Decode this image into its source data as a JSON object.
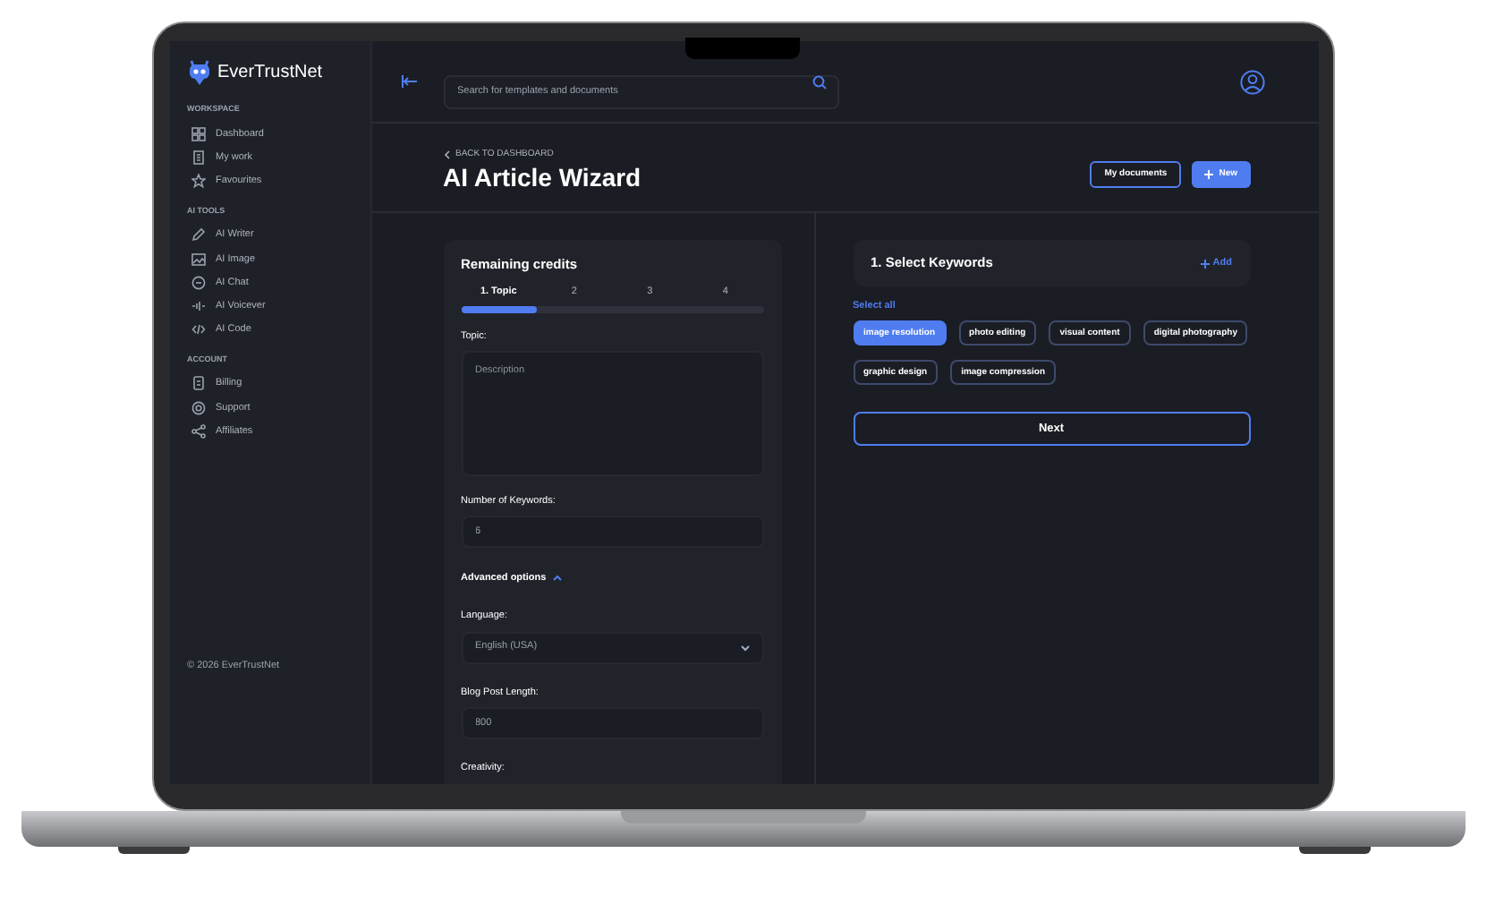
{
  "brand": {
    "name": "EverTrustNet"
  },
  "sidebar": {
    "sections": [
      {
        "title": "WORKSPACE",
        "items": [
          {
            "label": "Dashboard"
          },
          {
            "label": "My work"
          },
          {
            "label": "Favourites"
          }
        ]
      },
      {
        "title": "AI TOOLS",
        "items": [
          {
            "label": "AI Writer"
          },
          {
            "label": "AI Image"
          },
          {
            "label": "AI Chat"
          },
          {
            "label": "AI Voicever"
          },
          {
            "label": "AI Code"
          }
        ]
      },
      {
        "title": "ACCOUNT",
        "items": [
          {
            "label": "Billing"
          },
          {
            "label": "Support"
          },
          {
            "label": "Affiliates"
          }
        ]
      }
    ],
    "footer": "© 2026 EverTrustNet"
  },
  "search": {
    "placeholder": "Search for templates and documents"
  },
  "header": {
    "back_link": "BACK TO DASHBOARD",
    "title": "AI Article Wizard",
    "buttons": [
      {
        "label": "My documents",
        "kind": "outline"
      },
      {
        "label": "New",
        "kind": "primary"
      }
    ]
  },
  "wizard": {
    "title": "Remaining credits",
    "steps": [
      {
        "label": "1. Topic",
        "selected": true
      },
      {
        "label": "2",
        "selected": false
      },
      {
        "label": "3",
        "selected": false
      },
      {
        "label": "4",
        "selected": false
      }
    ],
    "progress": {
      "level": 0.25
    },
    "fields": [
      {
        "kind": "textarea",
        "label": "Topic:",
        "placeholder": "Description"
      },
      {
        "kind": "input",
        "label": "Number of Keywords:",
        "value": "6"
      },
      {
        "kind": "toggle",
        "label": "Advanced options",
        "expanded": true
      },
      {
        "kind": "select",
        "label": "Language:",
        "value": "English (USA)"
      },
      {
        "kind": "input",
        "label": "Blog Post Length:",
        "value": "800"
      },
      {
        "kind": "label",
        "label": "Creativity:"
      }
    ]
  },
  "keywords": {
    "title": "1. Select Keywords",
    "add": "Add",
    "select_all": "Select all",
    "chips": [
      {
        "label": "image resolution",
        "selected": true
      },
      {
        "label": "photo editing",
        "selected": false
      },
      {
        "label": "visual content",
        "selected": false
      },
      {
        "label": "digital photography",
        "selected": false
      },
      {
        "label": "graphic design",
        "selected": false
      },
      {
        "label": "image compression",
        "selected": false
      }
    ],
    "next": "Next"
  }
}
